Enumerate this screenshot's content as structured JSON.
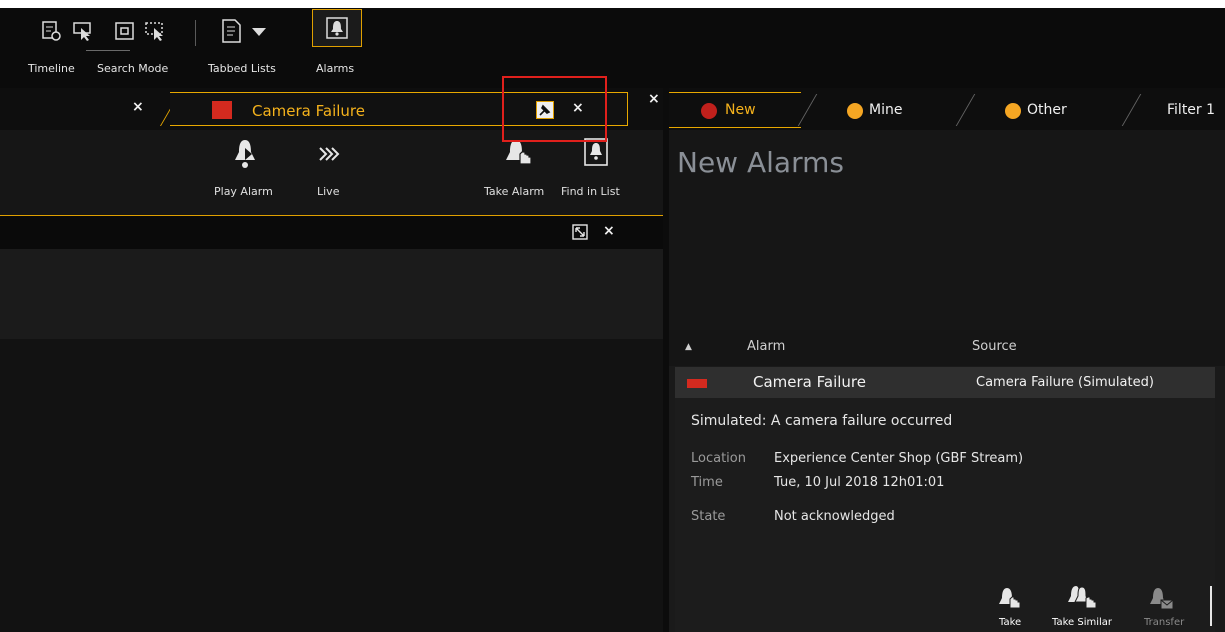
{
  "toolbar": {
    "items": [
      {
        "label": "Timeline",
        "icon": "timeline-icon"
      },
      {
        "label": "Search Mode",
        "icon": "search-mode-icon"
      },
      {
        "label": "Tabbed Lists",
        "icon": "tabbed-lists-icon"
      },
      {
        "label": "Alarms",
        "icon": "alarms-bell-icon"
      }
    ]
  },
  "left_panel": {
    "inactive_tab_close": "×",
    "active_tab": {
      "title": "Camera Failure",
      "close": "×"
    },
    "panel_close": "×",
    "actions": [
      {
        "label": "Play Alarm",
        "icon": "play-alarm-icon"
      },
      {
        "label": "Live",
        "icon": "live-icon"
      },
      {
        "label": "Take Alarm",
        "icon": "take-alarm-icon"
      },
      {
        "label": "Find in List",
        "icon": "find-in-list-icon"
      }
    ],
    "viewer_close": "×"
  },
  "right_panel": {
    "tabs": [
      {
        "label": "New",
        "dot_color": "#c0201c"
      },
      {
        "label": "Mine",
        "dot_color": "#f5a623"
      },
      {
        "label": "Other",
        "dot_color": "#f5a623"
      },
      {
        "label": "Filter 1"
      }
    ],
    "heading": "New Alarms",
    "columns": {
      "sort_indicator": "▲",
      "alarm": "Alarm",
      "source": "Source"
    },
    "selected_row": {
      "alarm": "Camera Failure",
      "source": "Camera Failure (Simulated)",
      "color": "#d42a1f"
    },
    "details": {
      "description": "Simulated:  A camera failure occurred",
      "location_label": "Location",
      "location_value": "Experience Center Shop (GBF Stream)",
      "time_label": "Time",
      "time_value": "Tue, 10 Jul 2018  12h01:01",
      "state_label": "State",
      "state_value": "Not acknowledged"
    },
    "bottom_actions": [
      {
        "label": "Take"
      },
      {
        "label": "Take Similar"
      },
      {
        "label": "Transfer",
        "disabled": true
      }
    ]
  },
  "colors": {
    "accent": "#e8a800",
    "highlight": "#e0201c",
    "title": "#f5b21c"
  }
}
